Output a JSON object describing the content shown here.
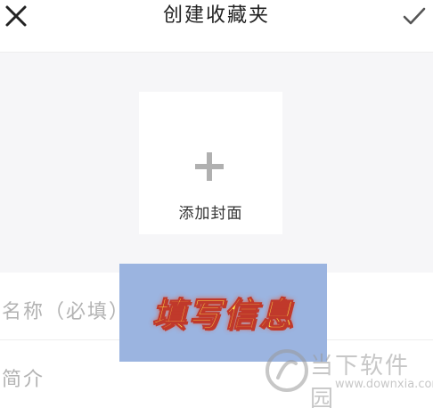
{
  "header": {
    "title": "创建收藏夹",
    "close_icon": "close-icon",
    "confirm_icon": "check-icon"
  },
  "cover": {
    "icon": "plus-icon",
    "label": "添加封面"
  },
  "form": {
    "name_placeholder": "名称（必填）",
    "intro_placeholder": "简介"
  },
  "overlay": {
    "text": "填写信息"
  },
  "watermark": {
    "name": "当下软件园",
    "url": "www.downxia.com"
  },
  "colors": {
    "background": "#f6f6f8",
    "overlay": "#9bb4e0",
    "overlay_text": "#ffe44a",
    "overlay_outline": "#c0392b",
    "placeholder": "#b3b3b3"
  }
}
